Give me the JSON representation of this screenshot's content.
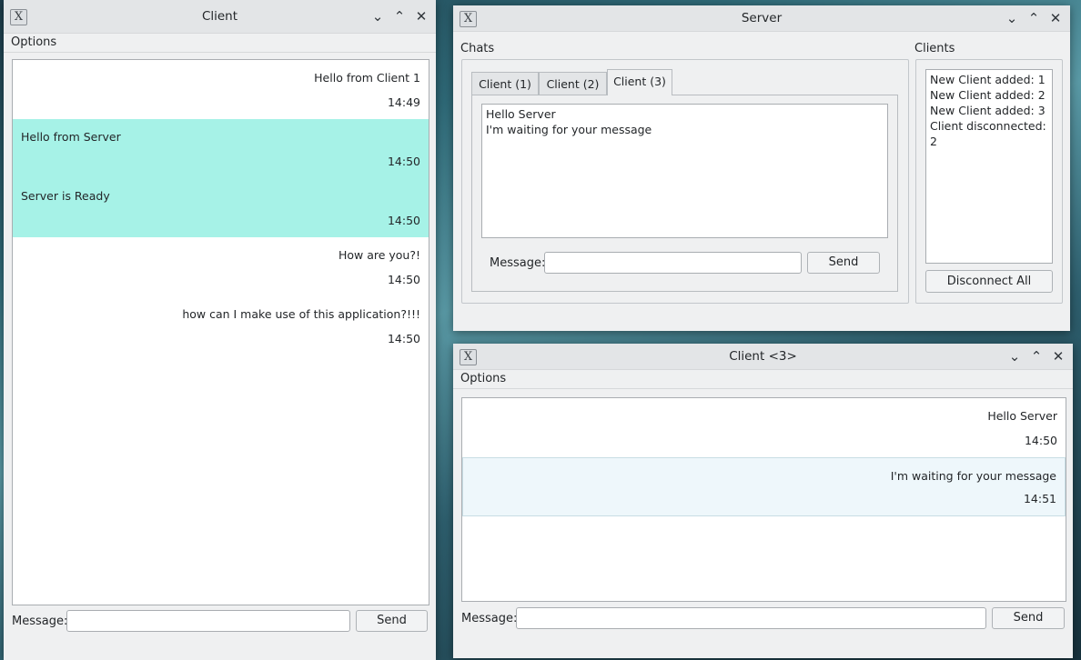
{
  "client1": {
    "title": "Client",
    "menu": "Options",
    "messages": [
      {
        "text": "Hello from Client 1",
        "time": "14:49",
        "align": "right",
        "highlight": false
      },
      {
        "text": "Hello  from Server",
        "time": "14:50",
        "align": "left",
        "highlight": true
      },
      {
        "text": "Server is Ready",
        "time": "14:50",
        "align": "left",
        "highlight": true
      },
      {
        "text": "How are you?!",
        "time": "14:50",
        "align": "right",
        "highlight": false
      },
      {
        "text": "how can I make use of this application?!!!",
        "time": "14:50",
        "align": "right",
        "highlight": false
      }
    ],
    "message_label": "Message:",
    "message_value": "",
    "send_label": "Send"
  },
  "server": {
    "title": "Server",
    "chats_label": "Chats",
    "clients_label": "Clients",
    "tabs": [
      {
        "label": "Client (1)",
        "active": false
      },
      {
        "label": "Client (2)",
        "active": false
      },
      {
        "label": "Client (3)",
        "active": true
      }
    ],
    "chat_lines": [
      "Hello Server",
      "I'm waiting for your message"
    ],
    "message_label": "Message:",
    "message_value": "",
    "send_label": "Send",
    "client_log": [
      "New Client added: 1",
      "New Client added: 2",
      "New Client added: 3",
      "Client disconnected: 2"
    ],
    "disconnect_label": "Disconnect All"
  },
  "client3": {
    "title": "Client <3>",
    "menu": "Options",
    "messages": [
      {
        "text": "Hello Server",
        "time": "14:50",
        "align": "right",
        "highlight": false
      },
      {
        "text": "I'm waiting for your message",
        "time": "14:51",
        "align": "right",
        "highlight": true
      }
    ],
    "message_label": "Message:",
    "message_value": "",
    "send_label": "Send"
  },
  "icons": {
    "app_icon": "x-app-icon",
    "minimize": "chevron-down-icon",
    "maximize": "chevron-up-icon",
    "close": "close-icon"
  },
  "colors": {
    "highlight_teal": "#a6f2e7",
    "highlight_light": "#eef7fb"
  }
}
